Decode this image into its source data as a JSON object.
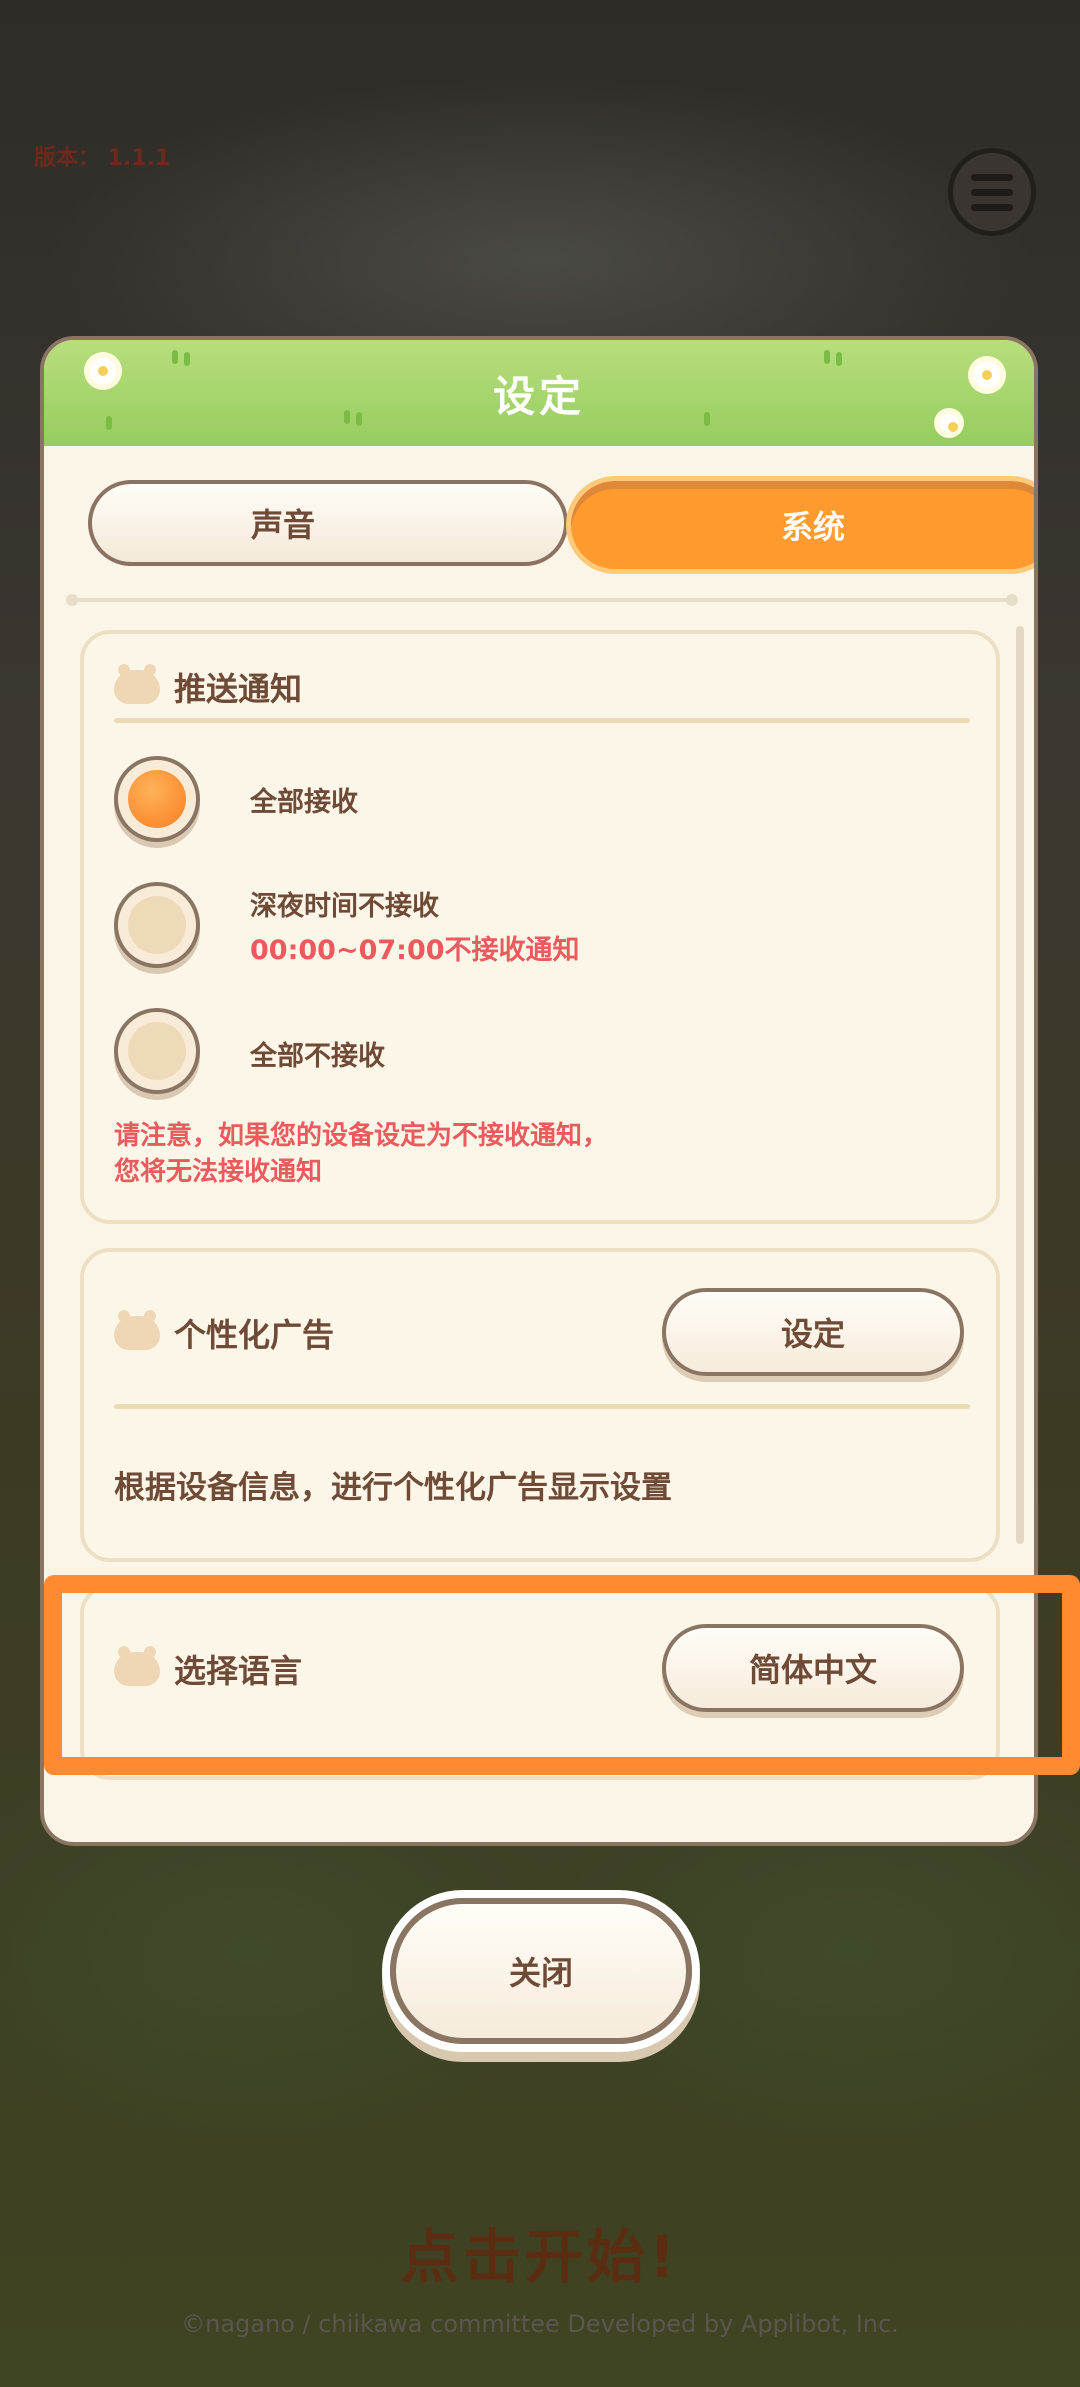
{
  "version_label": "版本： 1.1.1",
  "dialog": {
    "title": "设定",
    "tabs": {
      "sound": "声音",
      "system": "系统"
    },
    "push": {
      "title": "推送通知",
      "options": [
        {
          "label": "全部接收",
          "selected": true
        },
        {
          "label": "深夜时间不接收",
          "sub": "00:00~07:00不接收通知",
          "selected": false
        },
        {
          "label": "全部不接收",
          "selected": false
        }
      ],
      "warning_line1": "请注意，如果您的设备设定为不接收通知，",
      "warning_line2": "您将无法接收通知"
    },
    "ads": {
      "title": "个性化广告",
      "button": "设定",
      "description": "根据设备信息，进行个性化广告显示设置"
    },
    "language": {
      "title": "选择语言",
      "button": "简体中文"
    },
    "close_button": "关闭"
  },
  "background": {
    "tap_to_start": "点击开始!",
    "copyright": "©nagano / chiikawa committee    Developed by Applibot, Inc."
  },
  "colors": {
    "accent_orange": "#ff9a2e",
    "header_green": "#9fd266",
    "text_brown": "#6e4a37",
    "warning_red": "#eb5a5c",
    "highlight": "#ff8a30"
  }
}
